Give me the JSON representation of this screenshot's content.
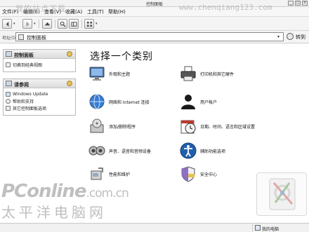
{
  "window": {
    "title": "控制面板"
  },
  "watermark": {
    "left": "我的站点下载",
    "right": "www.chenqiang123.com"
  },
  "menu": [
    "文件(F)",
    "编辑(E)",
    "查看(V)",
    "收藏(A)",
    "工具(T)",
    "帮助(H)"
  ],
  "address": {
    "label": "地址(D)",
    "value": "控制面板",
    "go_label": "转到"
  },
  "sidebar": {
    "panel1": {
      "title": "控制面板",
      "links": [
        "切换到经典视图"
      ]
    },
    "panel2": {
      "title": "请参阅",
      "links": [
        "Windows Update",
        "帮助和支持",
        "其它控制面板选项"
      ]
    }
  },
  "main": {
    "heading": "选择一个类别",
    "categories": [
      {
        "label": "外观和主题",
        "icon": "appearance-themes-icon"
      },
      {
        "label": "打印机和其它硬件",
        "icon": "printer-icon"
      },
      {
        "label": "网络和 Internet 连接",
        "icon": "network-globe-icon"
      },
      {
        "label": "用户帐户",
        "icon": "user-account-icon"
      },
      {
        "label": "添加/删除程序",
        "icon": "add-remove-programs-icon"
      },
      {
        "label": "日期、时间、语言和区域设置",
        "icon": "date-time-icon"
      },
      {
        "label": "声音、语音和音频设备",
        "icon": "speakers-icon"
      },
      {
        "label": "辅助功能选项",
        "icon": "accessibility-icon"
      },
      {
        "label": "性能和维护",
        "icon": "performance-icon"
      },
      {
        "label": "安全中心",
        "icon": "security-shield-icon"
      }
    ]
  },
  "logo": {
    "brand": "PConline",
    "domain": ".com.cn",
    "chinese": "太平洋电脑网"
  },
  "status": {
    "text": "我的电脑"
  }
}
